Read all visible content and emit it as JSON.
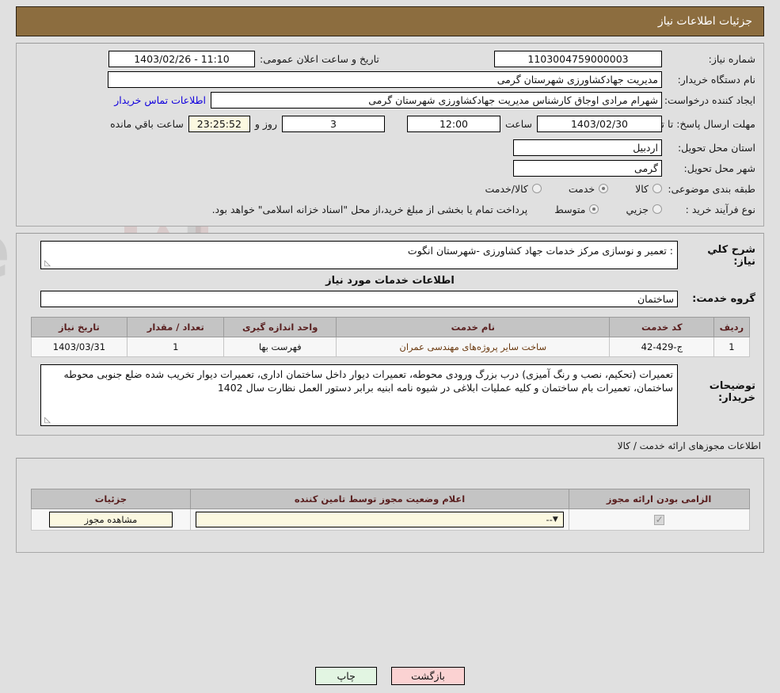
{
  "header": {
    "title": "جزئیات اطلاعات نیاز"
  },
  "info": {
    "need_number_label": "شماره نیاز:",
    "need_number_value": "1103004759000003",
    "announce_label": "تاریخ و ساعت اعلان عمومی:",
    "announce_value": "11:10 - 1403/02/26",
    "buyer_org_label": "نام دستگاه خریدار:",
    "buyer_org_value": "مدیریت جهادکشاورزی شهرستان گرمی",
    "creator_label": "ایجاد کننده درخواست:",
    "creator_value": "شهرام  مرادی اوجاق کارشناس مدیریت جهادکشاورزی شهرستان گرمی",
    "contact_link": "اطلاعات تماس خریدار",
    "deadline_label": "مهلت ارسال پاسخ: تا تاریخ:",
    "deadline_date": "1403/02/30",
    "hour_label": "ساعت",
    "hour_value": "12:00",
    "days_value": "3",
    "days_label": "روز و",
    "countdown_value": "23:25:52",
    "countdown_label": "ساعت باقي مانده",
    "province_label": "استان محل تحویل:",
    "province_value": "اردبیل",
    "city_label": "شهر محل تحویل:",
    "city_value": "گرمی",
    "category_label": "طبقه بندی موضوعی:",
    "category_options": [
      {
        "label": "کالا",
        "selected": false
      },
      {
        "label": "خدمت",
        "selected": true
      },
      {
        "label": "کالا/خدمت",
        "selected": false
      }
    ],
    "process_label": "نوع فرآیند خرید :",
    "process_options": [
      {
        "label": "جزیي",
        "selected": false
      },
      {
        "label": "متوسط",
        "selected": true
      }
    ],
    "treasury_note": "پرداخت تمام یا بخشی از مبلغ خرید،از محل \"اسناد خزانه اسلامی\" خواهد بود."
  },
  "need": {
    "overview_label": "شرح کلي نیاز:",
    "overview_value": ": تعمیر و نوسازی مرکز خدمات جهاد کشاورزی -شهرستان انگوت",
    "services_title": "اطلاعات خدمات مورد نیاز",
    "service_group_label": "گروه خدمت:",
    "service_group_value": "ساختمان"
  },
  "services_table": {
    "headers": [
      "ردیف",
      "کد خدمت",
      "نام خدمت",
      "واحد اندازه گیری",
      "تعداد / مقدار",
      "تاریخ نیاز"
    ],
    "rows": [
      {
        "row": "1",
        "code": "ج-429-42",
        "name": "ساخت سایر پروژه‌های مهندسی عمران",
        "unit": "فهرست بها",
        "qty": "1",
        "date": "1403/03/31"
      }
    ]
  },
  "buyer_notes": {
    "label": "توضیحات خریدار:",
    "value": "تعمیرات (تحکیم، نصب و رنگ آمیزی) درب بزرگ ورودی محوطه، تعمیرات دیوار داخل ساختمان اداری، تعمیرات دیوار تخریب شده ضلع جنوبی محوطه ساختمان، تعمیرات بام ساختمان و کلیه عملیات ابلاغی در شیوه نامه ابنیه برابر دستور العمل نظارت سال 1402"
  },
  "licenses": {
    "caption": "اطلاعات مجوزهای ارائه خدمت / کالا",
    "headers": [
      "الزامی بودن ارائه مجوز",
      "اعلام وضعیت مجوز توسط تامین کننده",
      "جزئیات"
    ],
    "rows": [
      {
        "required_checked": true,
        "status_value": "--",
        "details_button": "مشاهده مجوز"
      }
    ]
  },
  "footer": {
    "print_label": "چاپ",
    "back_label": "بازگشت"
  },
  "colors": {
    "header_bar": "#8c6d3f",
    "page_bg": "#e0e0e0",
    "link": "#1100dd",
    "table_header_bg": "#c4c4c4",
    "table_header_text": "#5a2020",
    "print_button": "#e2f5e2",
    "back_button": "#fbd2d2",
    "highlight_field": "#fbf8e0"
  },
  "watermark": {
    "text": "AriaTender.net"
  }
}
